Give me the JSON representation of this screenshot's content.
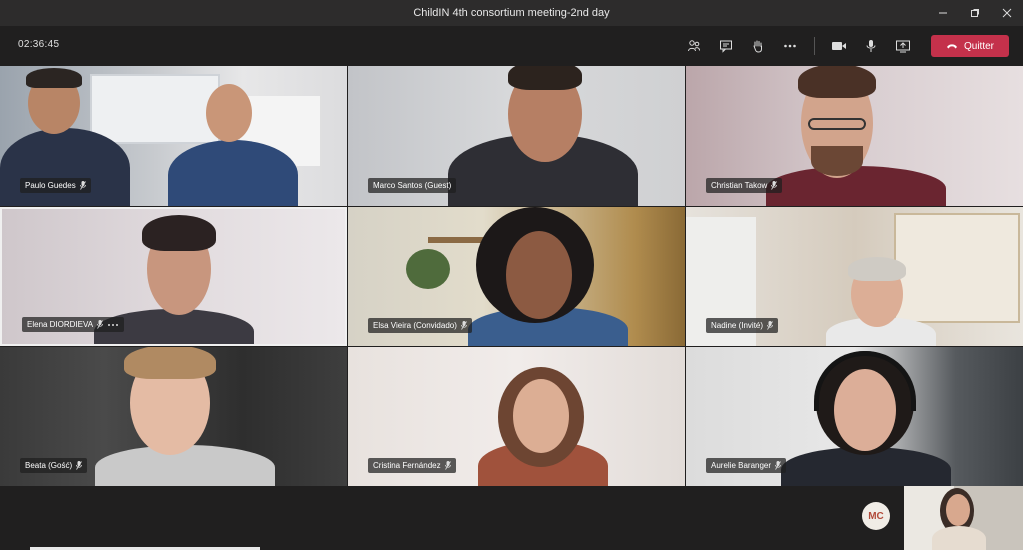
{
  "window": {
    "title": "ChildIN 4th consortium meeting-2nd day"
  },
  "call": {
    "timer": "02:36:45",
    "leave_label": "Quitter",
    "leave_color": "#c4314b"
  },
  "toolbar_icons": [
    "participants-icon",
    "chat-icon",
    "raise-hand-icon",
    "more-icon",
    "camera-icon",
    "mic-icon",
    "share-icon"
  ],
  "participants": [
    {
      "name": "Paulo Guedes"
    },
    {
      "name": "Marco Santos (Guest)"
    },
    {
      "name": "Christian Takow"
    },
    {
      "name": "Elena DIORDIEVA"
    },
    {
      "name": "Elsa Vieira (Convidado)"
    },
    {
      "name": "Nadine (Invité)"
    },
    {
      "name": "Beata (Gość)"
    },
    {
      "name": "Cristina Fernández"
    },
    {
      "name": "Aurelie Baranger"
    }
  ],
  "self": {
    "initials": "MC"
  }
}
